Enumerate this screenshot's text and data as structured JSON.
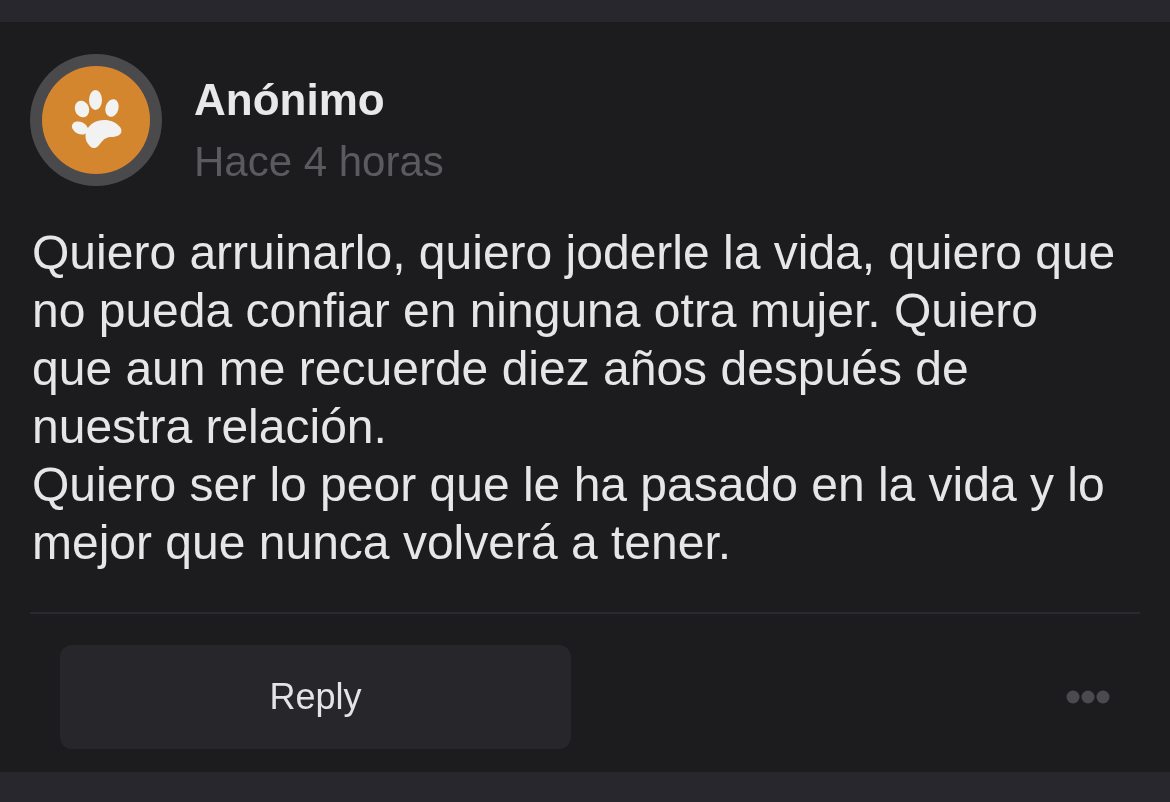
{
  "post": {
    "author": "Anónimo",
    "time": "Hace 4 horas",
    "paragraphs": [
      "Quiero arruinarlo, quiero joderle la vida, quiero que no pueda confiar en ninguna otra mujer. Quiero que aun me recuerde diez años después de nuestra relación.",
      "Quiero ser lo peor que le ha pasado en la vida y lo mejor que nunca volverá a tener."
    ]
  },
  "actions": {
    "reply": "Reply"
  }
}
